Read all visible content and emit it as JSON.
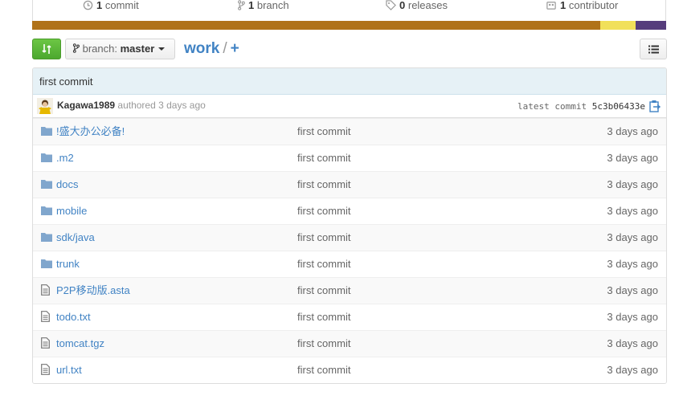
{
  "summary": {
    "commits": {
      "count": "1",
      "label": "commit",
      "icon": "history-icon"
    },
    "branches": {
      "count": "1",
      "label": "branch",
      "icon": "branch-icon"
    },
    "releases": {
      "count": "0",
      "label": "releases",
      "icon": "tag-icon"
    },
    "contributors": {
      "count": "1",
      "label": "contributor",
      "icon": "organization-icon"
    }
  },
  "language_bar": [
    {
      "color": "#b07219",
      "share": 0.896
    },
    {
      "color": "#f1e05a",
      "share": 0.056
    },
    {
      "color": "#563d7c",
      "share": 0.048
    }
  ],
  "toolbar": {
    "branch_label": "branch:",
    "branch_name": "master",
    "repo": "work",
    "separator": "/",
    "add": "+"
  },
  "latest_commit": {
    "message": "first commit",
    "author": "Kagawa1989",
    "authored": "authored",
    "ago": "3 days ago",
    "latest_label": "latest commit",
    "sha": "5c3b06433e"
  },
  "files": [
    {
      "name": "!盛大办公必备!",
      "type": "folder",
      "message": "first commit",
      "age": "3 days ago"
    },
    {
      "name": ".m2",
      "type": "folder",
      "message": "first commit",
      "age": "3 days ago"
    },
    {
      "name": "docs",
      "type": "folder",
      "message": "first commit",
      "age": "3 days ago"
    },
    {
      "name": "mobile",
      "type": "folder",
      "message": "first commit",
      "age": "3 days ago"
    },
    {
      "name": "sdk/java",
      "type": "folder",
      "message": "first commit",
      "age": "3 days ago"
    },
    {
      "name": "trunk",
      "type": "folder",
      "message": "first commit",
      "age": "3 days ago"
    },
    {
      "name": "P2P移动版.asta",
      "type": "file",
      "message": "first commit",
      "age": "3 days ago"
    },
    {
      "name": "todo.txt",
      "type": "file",
      "message": "first commit",
      "age": "3 days ago"
    },
    {
      "name": "tomcat.tgz",
      "type": "file",
      "message": "first commit",
      "age": "3 days ago"
    },
    {
      "name": "url.txt",
      "type": "file",
      "message": "first commit",
      "age": "3 days ago"
    }
  ]
}
